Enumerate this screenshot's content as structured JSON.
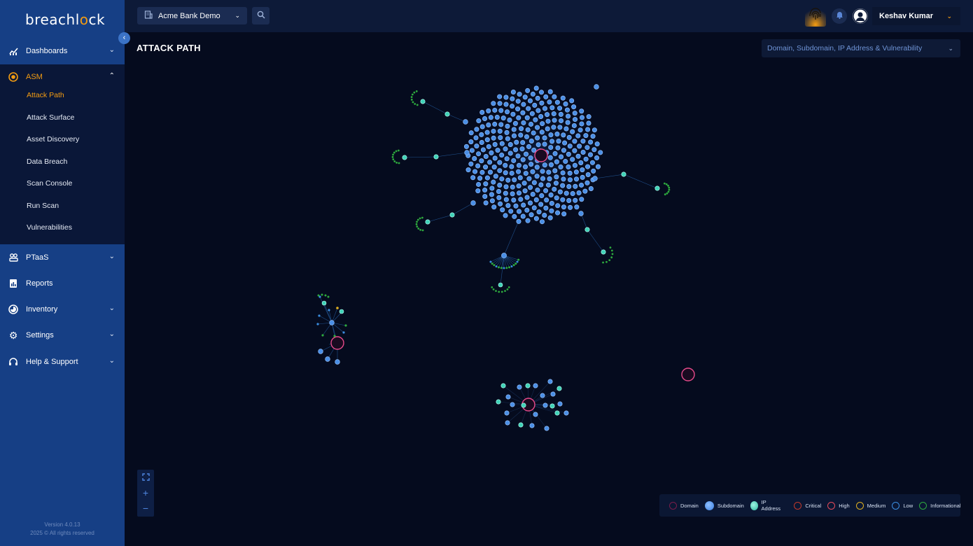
{
  "app": {
    "logo_text_start": "breachl",
    "logo_text_o": "o",
    "logo_text_end": "ck",
    "version": "Version 4.0.13",
    "copyright": "2025 © All rights reserved"
  },
  "sidebar": {
    "items": [
      {
        "label": "Dashboards",
        "icon": "chart-icon"
      },
      {
        "label": "ASM",
        "icon": "target-icon"
      },
      {
        "label": "PTaaS",
        "icon": "users-icon"
      },
      {
        "label": "Reports",
        "icon": "report-icon"
      },
      {
        "label": "Inventory",
        "icon": "inventory-icon"
      },
      {
        "label": "Settings",
        "icon": "gear-icon"
      },
      {
        "label": "Help & Support",
        "icon": "headset-icon"
      }
    ],
    "asm_subitems": [
      "Attack Path",
      "Attack Surface",
      "Asset Discovery",
      "Data Breach",
      "Scan Console",
      "Run Scan",
      "Vulnerabilities"
    ]
  },
  "topbar": {
    "org_name": "Acme Bank Demo",
    "user_name": "Keshav Kumar"
  },
  "main": {
    "title": "ATTACK PATH",
    "filter_value": "Domain, Subdomain, IP Address & Vulnerability"
  },
  "legend": {
    "domain": "Domain",
    "subdomain": "Subdomain",
    "ip": "IP Address",
    "critical": "Critical",
    "high": "High",
    "medium": "Medium",
    "low": "Low",
    "informational": "Informational"
  },
  "colors": {
    "accent": "#f39c12",
    "sidebar": "#163f85",
    "domain_ring": "#e64a8a",
    "subdomain": "#4a8ae0",
    "ip_address": "#3fd3b8",
    "critical": "#c0392b",
    "high": "#e64a5a",
    "medium": "#e0b020",
    "low": "#3b8de0",
    "informational": "#2eaa3e"
  }
}
